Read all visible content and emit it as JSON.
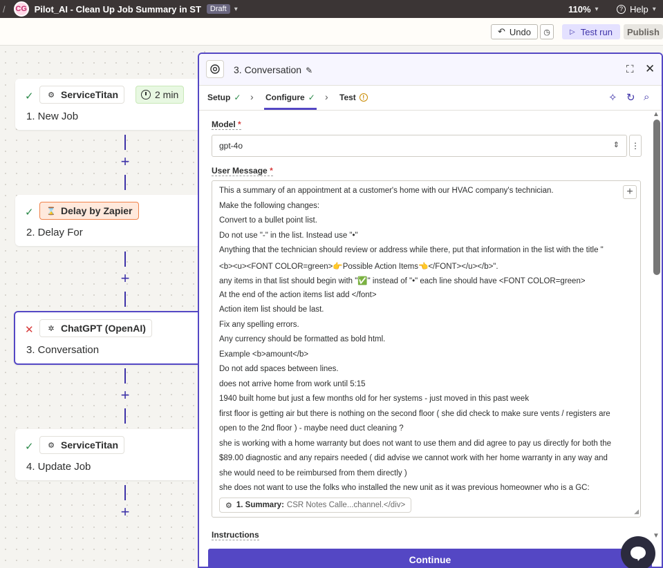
{
  "topbar": {
    "slash": "/",
    "avatar": "CG",
    "zap_title": "Pilot_AI - Clean Up Job Summary in ST",
    "status_badge": "Draft",
    "zoom": "110%",
    "help": "Help"
  },
  "toolbar": {
    "undo_label": "Undo",
    "test_run_label": "Test run",
    "publish_label": "Publish"
  },
  "steps": [
    {
      "status": "✓",
      "app": "ServiceTitan",
      "title": "1. New Job",
      "delay_badge": "2 min"
    },
    {
      "status": "✓",
      "app": "Delay by Zapier",
      "title": "2. Delay For"
    },
    {
      "status": "✕",
      "app": "ChatGPT (OpenAI)",
      "title": "3. Conversation"
    },
    {
      "status": "✓",
      "app": "ServiceTitan",
      "title": "4. Update Job"
    }
  ],
  "panel": {
    "title": "3. Conversation",
    "tabs": {
      "setup": "Setup",
      "configure": "Configure",
      "test": "Test"
    },
    "model_label": "Model",
    "model_value": "gpt-4o",
    "user_message_label": "User Message",
    "message_lines": [
      "This a summary of an appointment at a customer's home with our HVAC company's technician.",
      "Make the following changes:",
      "Convert to a bullet point list.",
      "Do not use \"-\" in the list. Instead use \"•\"",
      "Anything that the technician should review or address while there, put that information in the list with the title \"",
      "<b><u><FONT COLOR=green>👉Possible Action Items👈</FONT></u></b>\".",
      "any items in that list should begin with \"✅\" instead of \"•\" each line should have <FONT COLOR=green>",
      "At the end of the action items list add </font>",
      "Action item list should be last.",
      "Fix any spelling errors.",
      "Any currency should be formatted as bold html.",
      "Example <b>amount</b>",
      "Do not add spaces between lines.",
      "does not arrive home from work until 5:15",
      "1940 built home but just a few months old for her systems - just moved in this past week",
      "first floor is getting air but there is nothing on the second floor ( she did check to make sure vents / registers are",
      "open to the 2nd floor ) - maybe need duct cleaning ?",
      "she is working with a home warranty but does not want to use them and did agree to pay us directly for both the",
      "$89.00 diagnostic and any repairs needed ( did advise we cannot work with her home warranty in any way and",
      "she would need to be reimbursed from them directly )",
      "she does not want to use the folks who installed the new unit as it was previous homeowner who is a GC:"
    ],
    "pill_label": "1. Summary:",
    "pill_value": "CSR Notes Calle...channel.</div>",
    "instructions_label": "Instructions",
    "continue_label": "Continue",
    "required_mark": "*"
  },
  "colors": {
    "accent": "#5447c4",
    "success": "#2c8a4a",
    "error": "#d73b3b"
  }
}
